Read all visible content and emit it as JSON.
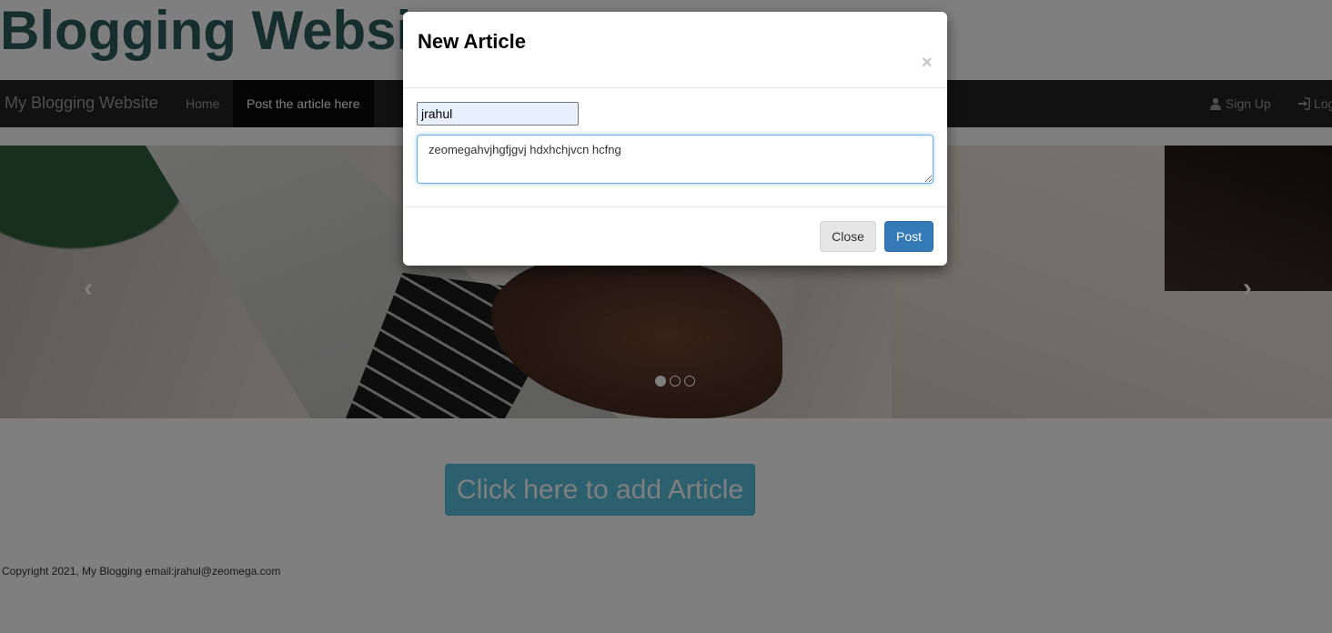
{
  "page": {
    "site_title": "Blogging Website"
  },
  "navbar": {
    "brand": "My Blogging Website",
    "items": [
      {
        "label": "Home"
      },
      {
        "label": "Post the article here",
        "active": true
      }
    ],
    "right_items": [
      {
        "label": "Sign Up",
        "icon": "user-icon"
      },
      {
        "label": "Login",
        "icon": "log-in-icon"
      }
    ]
  },
  "carousel": {
    "prev_icon": "chevron-left-icon",
    "next_icon": "chevron-right-icon",
    "prev_glyph": "‹",
    "next_glyph": "›",
    "indicator_count": 3,
    "active_index": 0
  },
  "main": {
    "add_article_label": "Click here to add Article"
  },
  "footer": {
    "text": "Copyright 2021, My Blogging email:jrahul@zeomega.com"
  },
  "modal": {
    "title": "New Article",
    "close_glyph": "×",
    "author_value": "jrahul",
    "content_value": "zeomegahvjhgfjgvj hdxhchjvcn hcfng",
    "close_label": "Close",
    "post_label": "Post"
  },
  "colors": {
    "title_color": "#2c5d5a",
    "navbar_bg": "#222222",
    "info_button": "#5bc0de",
    "primary_button": "#337ab7"
  }
}
